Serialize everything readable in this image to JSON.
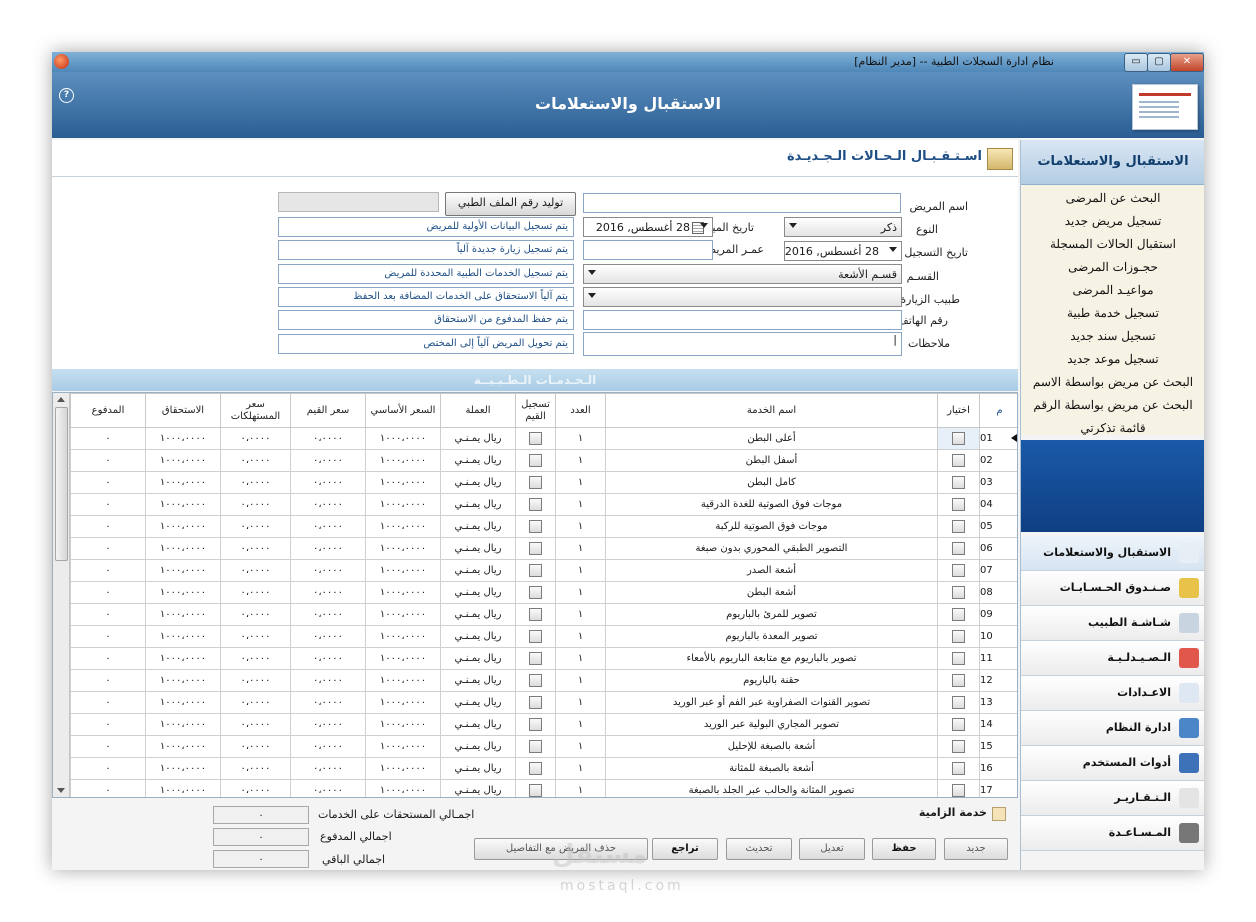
{
  "window": {
    "title": "نظام ادارة السجلات الطبية -- [مدير النظام]",
    "buttons": [
      "▭",
      "▢",
      "✕"
    ]
  },
  "banner": {
    "title": "الاستقبال والاستعلامات",
    "help": "?"
  },
  "section": {
    "title": "اسـتـقـبـال الـحـالات الـجـديـدة"
  },
  "form": {
    "patient_name_label": "اسم المريض",
    "generate_button": "توليد رقم الملف الطبي",
    "gender_label": "النوع",
    "gender_value": "ذكر",
    "birthdate_label": "تاريخ الميلاد",
    "birthdate_value": "28 أغسطس, 2016",
    "reg_date_label": "تاريخ التسجيل",
    "reg_date_value": "28 أغسطس, 2016",
    "age_label": "عمـر المريض",
    "dept_label": "القسـم",
    "dept_value": "قسـم الأشعة",
    "doctor_label": "طبيب الزيارة",
    "phone_label": "رقم الهاتف",
    "notes_label": "ملاحظات",
    "notes_value": "|",
    "info": [
      "يتم تسجيل البيانات الأولية للمريض",
      "يتم تسجيل زيارة جديدة آلياً",
      "يتم تسجيل الخدمات الطبية المحددة للمريض",
      "يتم آلياً الاستحقاق على الخدمات المضافة بعد الحفظ",
      "يتم حفظ المدفوع من الاستحقاق",
      "يتم تحويل المريض آلياً إلى المختص"
    ]
  },
  "grid": {
    "band_title": "الـخـدمـات الـطـبـيــة",
    "columns": [
      "م",
      "اختيار",
      "اسم الخدمة",
      "العدد",
      "تسجيل القيم",
      "العملة",
      "السعر الأساسي",
      "سعر القيم",
      "سعر المستهلكات",
      "الاستحقاق",
      "المدفوع"
    ],
    "rows": [
      {
        "n": "01",
        "name": "أعلى البطن",
        "qty": "١",
        "cur": "ريال يمـنـي",
        "base": "١٠٠٠،٠٠٠٠",
        "val": "٠،٠٠٠٠",
        "cons": "٠،٠٠٠٠",
        "due": "١٠٠٠،٠٠٠٠",
        "paid": "٠"
      },
      {
        "n": "02",
        "name": "أسفل البطن",
        "qty": "١",
        "cur": "ريال يمـنـي",
        "base": "١٠٠٠،٠٠٠٠",
        "val": "٠،٠٠٠٠",
        "cons": "٠،٠٠٠٠",
        "due": "١٠٠٠،٠٠٠٠",
        "paid": "٠"
      },
      {
        "n": "03",
        "name": "كامل البطن",
        "qty": "١",
        "cur": "ريال يمـنـي",
        "base": "١٠٠٠،٠٠٠٠",
        "val": "٠،٠٠٠٠",
        "cons": "٠،٠٠٠٠",
        "due": "١٠٠٠،٠٠٠٠",
        "paid": "٠"
      },
      {
        "n": "04",
        "name": "موجات فوق الصوتية للغدة الدرقية",
        "qty": "١",
        "cur": "ريال يمـنـي",
        "base": "١٠٠٠،٠٠٠٠",
        "val": "٠،٠٠٠٠",
        "cons": "٠،٠٠٠٠",
        "due": "١٠٠٠،٠٠٠٠",
        "paid": "٠"
      },
      {
        "n": "05",
        "name": "موجات فوق الصوتية للركبة",
        "qty": "١",
        "cur": "ريال يمـنـي",
        "base": "١٠٠٠،٠٠٠٠",
        "val": "٠،٠٠٠٠",
        "cons": "٠،٠٠٠٠",
        "due": "١٠٠٠،٠٠٠٠",
        "paid": "٠"
      },
      {
        "n": "06",
        "name": "التصوير الطبقي المحوري بدون صبغة",
        "qty": "١",
        "cur": "ريال يمـنـي",
        "base": "١٠٠٠،٠٠٠٠",
        "val": "٠،٠٠٠٠",
        "cons": "٠،٠٠٠٠",
        "due": "١٠٠٠،٠٠٠٠",
        "paid": "٠"
      },
      {
        "n": "07",
        "name": "أشعة الصدر",
        "qty": "١",
        "cur": "ريال يمـنـي",
        "base": "١٠٠٠،٠٠٠٠",
        "val": "٠،٠٠٠٠",
        "cons": "٠،٠٠٠٠",
        "due": "١٠٠٠،٠٠٠٠",
        "paid": "٠"
      },
      {
        "n": "08",
        "name": "أشعة البطن",
        "qty": "١",
        "cur": "ريال يمـنـي",
        "base": "١٠٠٠،٠٠٠٠",
        "val": "٠،٠٠٠٠",
        "cons": "٠،٠٠٠٠",
        "due": "١٠٠٠،٠٠٠٠",
        "paid": "٠"
      },
      {
        "n": "09",
        "name": "تصوير للمرئ بالباريوم",
        "qty": "١",
        "cur": "ريال يمـنـي",
        "base": "١٠٠٠،٠٠٠٠",
        "val": "٠،٠٠٠٠",
        "cons": "٠،٠٠٠٠",
        "due": "١٠٠٠،٠٠٠٠",
        "paid": "٠"
      },
      {
        "n": "10",
        "name": "تصوير المعدة بالباريوم",
        "qty": "١",
        "cur": "ريال يمـنـي",
        "base": "١٠٠٠،٠٠٠٠",
        "val": "٠،٠٠٠٠",
        "cons": "٠،٠٠٠٠",
        "due": "١٠٠٠،٠٠٠٠",
        "paid": "٠"
      },
      {
        "n": "11",
        "name": "تصوير بالباريوم مع متابعة الباريوم بالأمعاء",
        "qty": "١",
        "cur": "ريال يمـنـي",
        "base": "١٠٠٠،٠٠٠٠",
        "val": "٠،٠٠٠٠",
        "cons": "٠،٠٠٠٠",
        "due": "١٠٠٠،٠٠٠٠",
        "paid": "٠"
      },
      {
        "n": "12",
        "name": "حقنة بالباريوم",
        "qty": "١",
        "cur": "ريال يمـنـي",
        "base": "١٠٠٠،٠٠٠٠",
        "val": "٠،٠٠٠٠",
        "cons": "٠،٠٠٠٠",
        "due": "١٠٠٠،٠٠٠٠",
        "paid": "٠"
      },
      {
        "n": "13",
        "name": "تصوير القنوات الصفراوية عبر الفم أو عبر الوريد",
        "qty": "١",
        "cur": "ريال يمـنـي",
        "base": "١٠٠٠،٠٠٠٠",
        "val": "٠،٠٠٠٠",
        "cons": "٠،٠٠٠٠",
        "due": "١٠٠٠،٠٠٠٠",
        "paid": "٠"
      },
      {
        "n": "14",
        "name": "تصوير المجاري البولية عبر الوريد",
        "qty": "١",
        "cur": "ريال يمـنـي",
        "base": "١٠٠٠،٠٠٠٠",
        "val": "٠،٠٠٠٠",
        "cons": "٠،٠٠٠٠",
        "due": "١٠٠٠،٠٠٠٠",
        "paid": "٠"
      },
      {
        "n": "15",
        "name": "أشعة بالصبغة للإحليل",
        "qty": "١",
        "cur": "ريال يمـنـي",
        "base": "١٠٠٠،٠٠٠٠",
        "val": "٠،٠٠٠٠",
        "cons": "٠،٠٠٠٠",
        "due": "١٠٠٠،٠٠٠٠",
        "paid": "٠"
      },
      {
        "n": "16",
        "name": "أشعة بالصبغة للمثانة",
        "qty": "١",
        "cur": "ريال يمـنـي",
        "base": "١٠٠٠،٠٠٠٠",
        "val": "٠،٠٠٠٠",
        "cons": "٠،٠٠٠٠",
        "due": "١٠٠٠،٠٠٠٠",
        "paid": "٠"
      },
      {
        "n": "17",
        "name": "تصوير المثانة والحالب عبر الجلد بالصبغة",
        "qty": "١",
        "cur": "ريال يمـنـي",
        "base": "١٠٠٠،٠٠٠٠",
        "val": "٠،٠٠٠٠",
        "cons": "٠،٠٠٠٠",
        "due": "١٠٠٠،٠٠٠٠",
        "paid": "٠"
      }
    ]
  },
  "totals": {
    "due_label": "اجمـالي المستحقات على الخدمات",
    "due_value": "٠",
    "paid_label": "اجمالي المدفوع",
    "paid_value": "٠",
    "remaining_label": "اجمالي الباقي",
    "remaining_value": "٠",
    "mandatory_label": "خدمة الزامية"
  },
  "actions": {
    "new": "جديد",
    "save": "حفظ",
    "edit": "تعديل",
    "update": "تحديث",
    "undo": "تراجع",
    "delete": "حذف المريض مع التفاصيل"
  },
  "sidebar": {
    "header": "الاستقبال والاستعلامات",
    "links": [
      "البحث عن المرضى",
      "تسجيل مريض جديد",
      "استقبال الحالات المسجلة",
      "حجـوزات المرضى",
      "مواعيـد المرضى",
      "تسجيل خدمة طبية",
      "تسجيل سند جديد",
      "تسجيل موعد جديد",
      "البحث عن مريض بواسطة الاسم",
      "البحث عن مريض بواسطة الرقم",
      "قائمة تذكرتي"
    ],
    "dots": "........",
    "nav": [
      {
        "label": "الاستقبال والاستعلامات",
        "icon": "reception-icon",
        "color": "#e8eef6"
      },
      {
        "label": "صـنـدوق الحـسـابـات",
        "icon": "cashbox-icon",
        "color": "#e9c24a"
      },
      {
        "label": "شـاشـة الطبيب",
        "icon": "doctor-icon",
        "color": "#c8d4e0"
      },
      {
        "label": "الـصـيـدلـيـة",
        "icon": "pharmacy-icon",
        "color": "#e2574c"
      },
      {
        "label": "الاعـدادات",
        "icon": "settings-icon",
        "color": "#dfe8f2"
      },
      {
        "label": "ادارة النظام",
        "icon": "system-icon",
        "color": "#4a86c8"
      },
      {
        "label": "أدوات المستخدم",
        "icon": "user-tools-icon",
        "color": "#3d72b8"
      },
      {
        "label": "الـتـقـاريـر",
        "icon": "reports-icon",
        "color": "#e4e4e4"
      },
      {
        "label": "المـسـاعـدة",
        "icon": "help-book-icon",
        "color": "#777777"
      }
    ]
  },
  "watermark": {
    "text": "مستقل",
    "sub": "mostaql.com"
  }
}
